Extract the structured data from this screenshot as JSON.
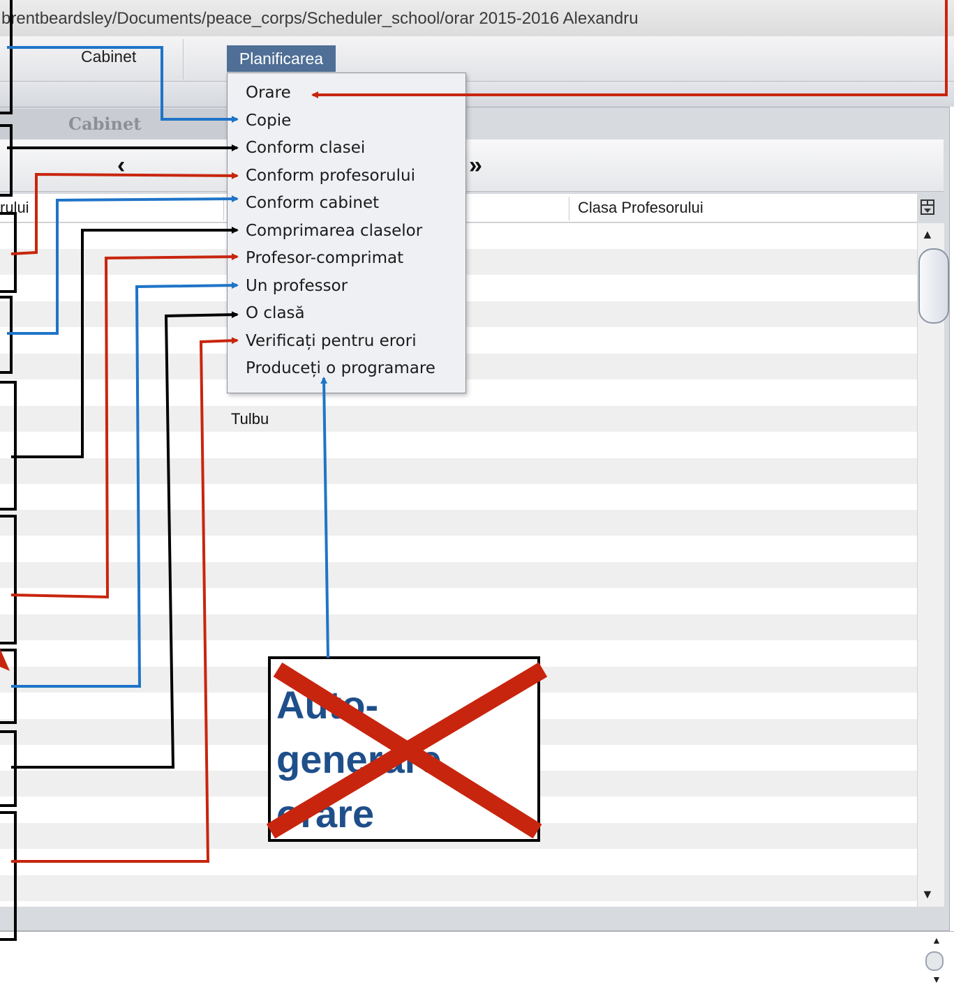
{
  "window": {
    "title": "brentbeardsley/Documents/peace_corps/Scheduler_school/orar 2015-2016 Alexandru"
  },
  "menubar": {
    "items": [
      "Cabinet",
      "Planificarea"
    ]
  },
  "tabs": {
    "active_label": "Cabinet"
  },
  "navigation": {
    "prev": "‹",
    "last": "»"
  },
  "table": {
    "columns": [
      "rului",
      "",
      "Clasa Profesorului"
    ],
    "visible_cell": "Tulbu"
  },
  "dropdown": {
    "items": [
      "Orare",
      "Copie",
      "Conform clasei",
      "Conform profesorului",
      "Conform cabinet",
      "Comprimarea claselor",
      "Profesor-comprimat",
      "Un professor",
      "O clasă",
      "Verificați pentru erori",
      "Produceți o programare"
    ]
  },
  "annotation": {
    "auto_generate": [
      "Auto-",
      "generare",
      "orare"
    ],
    "colors": {
      "red": "#c8250e",
      "blue": "#1f74c8",
      "black": "#000000",
      "text_blue": "#1f4f8a"
    }
  },
  "icons": {
    "column_menu": "column-chooser-icon",
    "scroll_up": "arrow-up-icon",
    "scroll_down": "arrow-down-icon"
  }
}
